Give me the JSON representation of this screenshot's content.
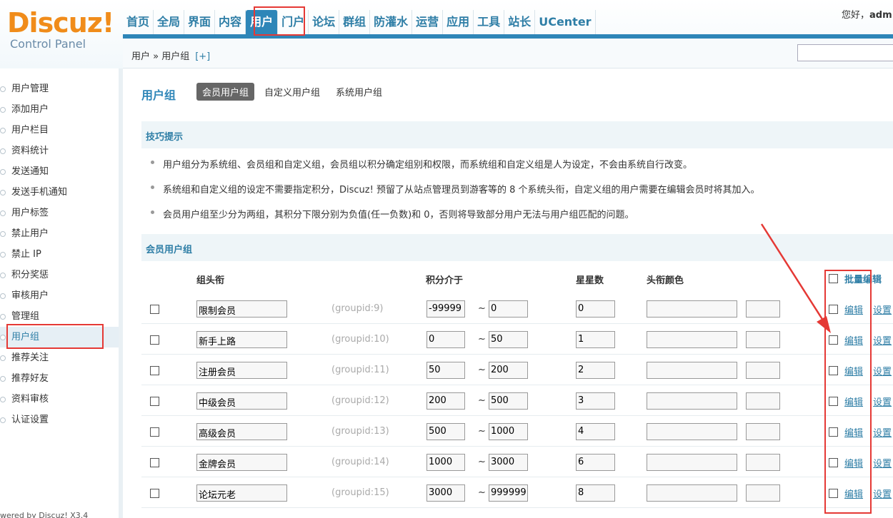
{
  "logo": {
    "main": "Discuz!",
    "sub": "Control Panel"
  },
  "nav": [
    {
      "label": "首页"
    },
    {
      "label": "全局"
    },
    {
      "label": "界面"
    },
    {
      "label": "内容"
    },
    {
      "label": "用户"
    },
    {
      "label": "门户"
    },
    {
      "label": "论坛"
    },
    {
      "label": "群组"
    },
    {
      "label": "防灌水"
    },
    {
      "label": "运营"
    },
    {
      "label": "应用"
    },
    {
      "label": "工具"
    },
    {
      "label": "站长"
    },
    {
      "label": "UCenter"
    }
  ],
  "greeting": {
    "prefix": "您好，",
    "user": "adm"
  },
  "breadcrumb": {
    "text": "用户 » 用户组",
    "plus": "[+]"
  },
  "sidebar": {
    "items": [
      {
        "label": "用户管理"
      },
      {
        "label": "添加用户"
      },
      {
        "label": "用户栏目"
      },
      {
        "label": "资料统计"
      },
      {
        "label": "发送通知"
      },
      {
        "label": "发送手机通知"
      },
      {
        "label": "用户标签"
      },
      {
        "label": "禁止用户"
      },
      {
        "label": "禁止 IP"
      },
      {
        "label": "积分奖惩"
      },
      {
        "label": "审核用户"
      },
      {
        "label": "管理组"
      },
      {
        "label": "用户组"
      },
      {
        "label": "推荐关注"
      },
      {
        "label": "推荐好友"
      },
      {
        "label": "资料审核"
      },
      {
        "label": "认证设置"
      }
    ],
    "footer": "wered by Discuz! X3.4"
  },
  "page": {
    "title": "用户组",
    "tabs": [
      {
        "label": "会员用户组"
      },
      {
        "label": "自定义用户组"
      },
      {
        "label": "系统用户组"
      }
    ]
  },
  "tips": {
    "title": "技巧提示",
    "items": [
      "用户组分为系统组、会员组和自定义组，会员组以积分确定组别和权限，而系统组和自定义组是人为设定，不会由系统自行改变。",
      "系统组和自定义组的设定不需要指定积分，Discuz! 预留了从站点管理员到游客等的 8 个系统头衔，自定义组的用户需要在编辑会员时将其加入。",
      "会员用户组至少分为两组，其积分下限分别为负值(任一负数)和 0，否则将导致部分用户无法与用户组匹配的问题。"
    ]
  },
  "table": {
    "section_title": "会员用户组",
    "headers": {
      "title": "组头衔",
      "credits": "积分介于",
      "stars": "星星数",
      "color": "头衔颜色",
      "bulk": "批量编辑"
    },
    "tilde": "~",
    "edit_label": "编辑",
    "settings_label": "设置",
    "rows": [
      {
        "title": "限制会员",
        "gid": "(groupid:9)",
        "low": "-99999",
        "high": "0",
        "stars": "0"
      },
      {
        "title": "新手上路",
        "gid": "(groupid:10)",
        "low": "0",
        "high": "50",
        "stars": "1"
      },
      {
        "title": "注册会员",
        "gid": "(groupid:11)",
        "low": "50",
        "high": "200",
        "stars": "2"
      },
      {
        "title": "中级会员",
        "gid": "(groupid:12)",
        "low": "200",
        "high": "500",
        "stars": "3"
      },
      {
        "title": "高级会员",
        "gid": "(groupid:13)",
        "low": "500",
        "high": "1000",
        "stars": "4"
      },
      {
        "title": "金牌会员",
        "gid": "(groupid:14)",
        "low": "1000",
        "high": "3000",
        "stars": "6"
      },
      {
        "title": "论坛元老",
        "gid": "(groupid:15)",
        "low": "3000",
        "high": "999999",
        "stars": "8"
      }
    ]
  },
  "colors": {
    "accent": "#2e86b8",
    "logo": "#f08c1a",
    "highlight": "#e53935"
  }
}
